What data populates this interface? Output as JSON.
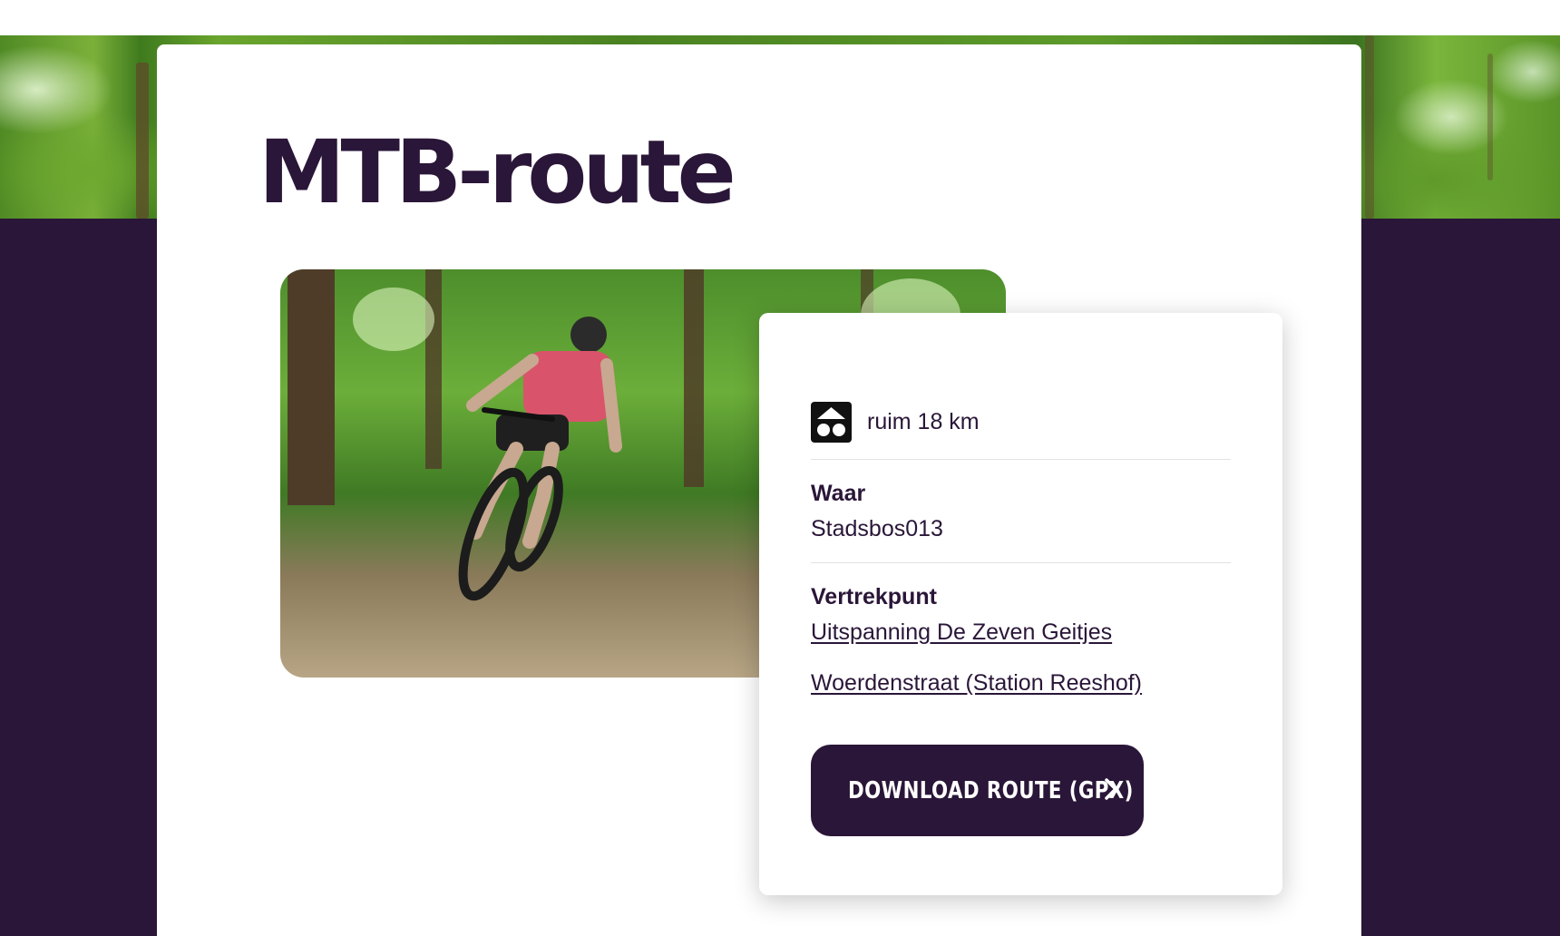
{
  "page": {
    "title": "MTB-route"
  },
  "route": {
    "distance": "ruim 18 km",
    "distance_icon": "route-distance-icon",
    "where_label": "Waar",
    "where_value": "Stadsbos013",
    "start_label": "Vertrekpunt",
    "start_points": [
      "Uitspanning De Zeven Geitjes",
      "Woerdenstraat (Station Reeshof)"
    ],
    "download_label": "DOWNLOAD ROUTE (GPX)",
    "download_icon": "chevron-right-icon"
  },
  "colors": {
    "brand_dark": "#2a1638",
    "background": "#ffffff"
  }
}
